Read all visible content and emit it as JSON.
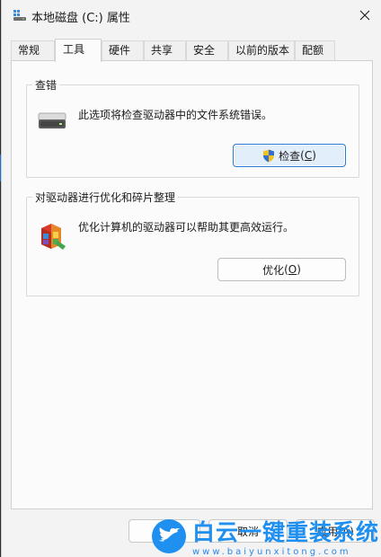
{
  "window": {
    "title": "本地磁盘 (C:) 属性"
  },
  "tabs": [
    {
      "label": "常规",
      "active": false
    },
    {
      "label": "工具",
      "active": true
    },
    {
      "label": "硬件",
      "active": false
    },
    {
      "label": "共享",
      "active": false
    },
    {
      "label": "安全",
      "active": false
    },
    {
      "label": "以前的版本",
      "active": false
    },
    {
      "label": "配额",
      "active": false
    }
  ],
  "error_check": {
    "group_label": "查错",
    "description": "此选项将检查驱动器中的文件系统错误。",
    "button_text": "检查",
    "button_key": "C",
    "icon": "drive-icon"
  },
  "optimize": {
    "group_label": "对驱动器进行优化和碎片整理",
    "description": "优化计算机的驱动器可以帮助其更高效运行。",
    "button_text": "优化",
    "button_key": "O",
    "icon": "defrag-icon"
  },
  "footer": {
    "cancel_label": "取消",
    "apply_label": "应用(A)"
  },
  "watermark": {
    "brand": "白云一键重装系统",
    "url": "www.baiyunxitong.com"
  },
  "colors": {
    "accent": "#2b79d0",
    "watermark_blue": "#1f8ff0"
  }
}
